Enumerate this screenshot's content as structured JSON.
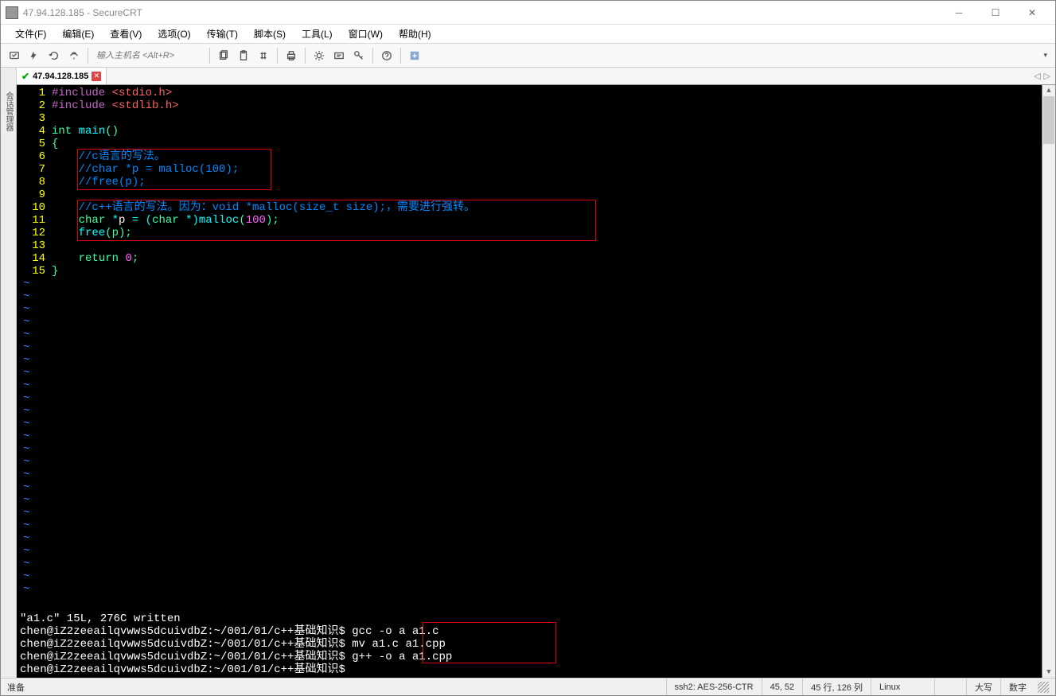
{
  "window": {
    "title": "47.94.128.185 - SecureCRT"
  },
  "menu": {
    "file": "文件(F)",
    "edit": "编辑(E)",
    "view": "查看(V)",
    "options": "选项(O)",
    "transfer": "传输(T)",
    "script": "脚本(S)",
    "tools": "工具(L)",
    "window": "窗口(W)",
    "help": "帮助(H)"
  },
  "toolbar": {
    "host_placeholder": "输入主机名 <Alt+R>"
  },
  "sidebar": {
    "label": "会话管理器"
  },
  "tab": {
    "label": "47.94.128.185"
  },
  "code": {
    "l1_include": "#include",
    "l1_header": "<stdio.h>",
    "l2_include": "#include",
    "l2_header": "<stdlib.h>",
    "l4_int": "int",
    "l4_main": " main",
    "l4_paren": "()",
    "l5_brace": "{",
    "l6_comment": "//c语言的写法。",
    "l7_comment": "//char *p = malloc(100);",
    "l8_comment": "//free(p);",
    "l10_comment": "//c++语言的写法。因为：void *malloc(size_t size);，需要进行强转。",
    "l11_char": "char",
    "l11_star": " *",
    "l11_p": "p ",
    "l11_eq": "= (",
    "l11_char2": "char",
    "l11_cast": " *)",
    "l11_malloc": "malloc",
    "l11_open": "(",
    "l11_num": "100",
    "l11_close": ");",
    "l12_free": "free",
    "l12_args": "(p);",
    "l14_return": "return",
    "l14_sp": " ",
    "l14_zero": "0",
    "l14_semi": ";",
    "l15_brace": "}"
  },
  "terminal": {
    "status": "\"a1.c\" 15L, 276C written",
    "prompt": "chen@iZ2zeeailqvwws5dcuivdbZ:~/001/01/c++基础知识$",
    "cmd1": " gcc -o a a1.c",
    "cmd2": " mv a1.c a1.cpp",
    "cmd3": " g++ -o a a1.cpp",
    "cmd4": ""
  },
  "status": {
    "ready": "准备",
    "ssh": "ssh2: AES-256-CTR",
    "pos": "45,  52",
    "size": "45 行, 126 列",
    "term": "Linux",
    "caps": "大写",
    "num": "数字"
  },
  "linenumbers": [
    "1",
    "2",
    "3",
    "4",
    "5",
    "6",
    "7",
    "8",
    "9",
    "10",
    "11",
    "12",
    "13",
    "14",
    "15"
  ]
}
